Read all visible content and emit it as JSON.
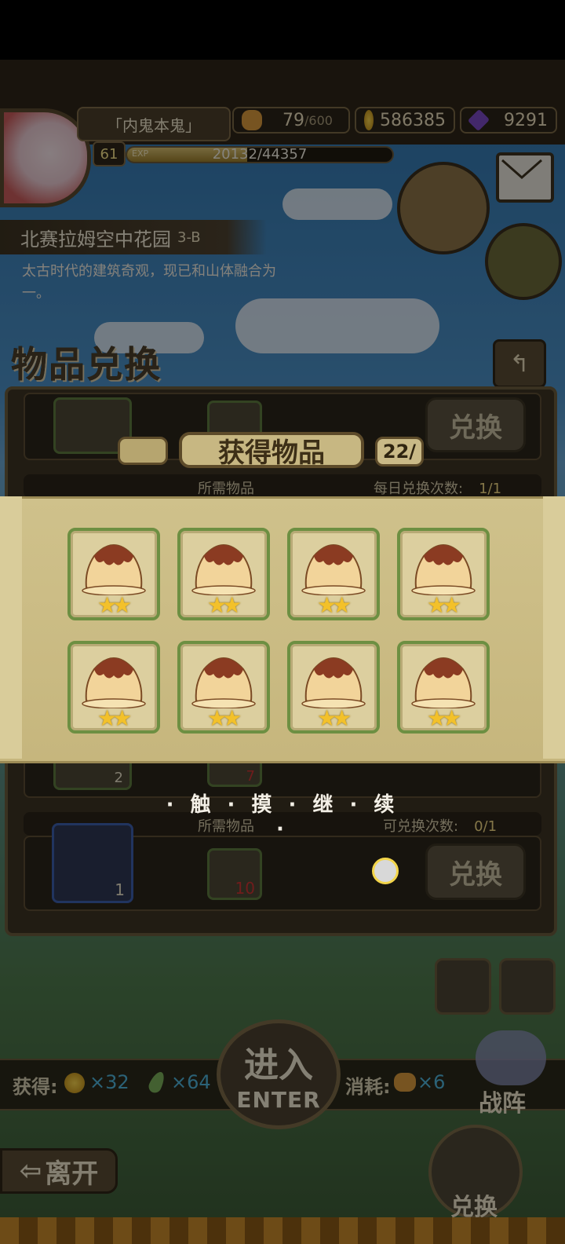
{
  "header": {
    "player_name": "「内鬼本鬼」",
    "level": "61",
    "exp_tag": "EXP",
    "exp_text": "20132/44357",
    "exp_progress": 0.4539,
    "stamina": "79",
    "stamina_max": "/600",
    "gold": "586385",
    "gems": "9291"
  },
  "location": {
    "name": "北赛拉姆空中花园",
    "stage": "3-B",
    "description": "太古时代的建筑奇观，现已和山体融合为一。"
  },
  "exchange_window": {
    "title": "物品兑换",
    "rows": [
      {
        "required_label": "所需物品",
        "count_label": "每日兑换次数:",
        "count_value": "1/1",
        "button": "兑换"
      },
      {
        "required_label": "",
        "count_label": "",
        "count_value": "",
        "button": "",
        "left_count": "2",
        "req_count": "7"
      },
      {
        "required_label": "所需物品",
        "count_label": "可兑换次数:",
        "count_value": "0/1",
        "button": "兑换",
        "left_count": "1",
        "req_count": "10"
      }
    ]
  },
  "popup": {
    "title": "获得物品",
    "count": "22/",
    "rewards": [
      {
        "name": "pudding",
        "stars": 2
      },
      {
        "name": "pudding",
        "stars": 2
      },
      {
        "name": "pudding",
        "stars": 2
      },
      {
        "name": "pudding",
        "stars": 2
      },
      {
        "name": "pudding",
        "stars": 2
      },
      {
        "name": "pudding",
        "stars": 2
      },
      {
        "name": "pudding",
        "stars": 2
      },
      {
        "name": "pudding",
        "stars": 2
      }
    ],
    "touch_hint": "· 触 · 摸 · 继 · 续 ·"
  },
  "hud": {
    "obtain_label": "获得:",
    "obtain_gold": "×32",
    "obtain_feather": "×64",
    "cost_label": "消耗:",
    "cost_bread": "×6",
    "enter_cn": "进入",
    "enter_en": "ENTER",
    "formation": "战阵",
    "exchange": "兑换",
    "leave": "离开"
  },
  "colors": {
    "gold": "#f3c12a",
    "frame": "#6b5b3c",
    "popup_bg": "#cfc18b"
  }
}
